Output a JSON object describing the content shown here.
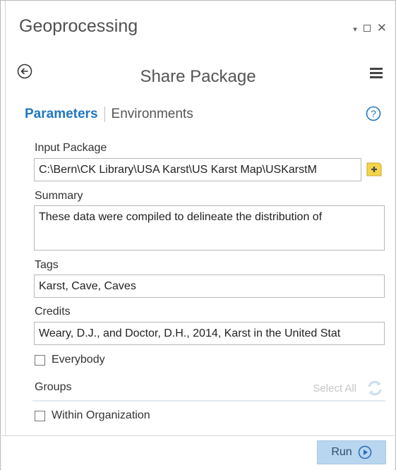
{
  "pane": {
    "title": "Geoprocessing",
    "pin_glyph": "▾",
    "close_glyph": "✕"
  },
  "tool": {
    "title": "Share Package"
  },
  "tabs": {
    "parameters": "Parameters",
    "environments": "Environments"
  },
  "fields": {
    "input_package": {
      "label": "Input Package",
      "value": "C:\\Bern\\CK Library\\USA Karst\\US Karst Map\\USKarstM"
    },
    "summary": {
      "label": "Summary",
      "value": "These data were compiled to delineate the distribution of"
    },
    "tags": {
      "label": "Tags",
      "value": "Karst, Cave, Caves"
    },
    "credits": {
      "label": "Credits",
      "value": "Weary, D.J., and Doctor, D.H., 2014, Karst in the United Stat"
    }
  },
  "options": {
    "everybody": "Everybody",
    "groups_label": "Groups",
    "select_all": "Select All",
    "within_org": "Within Organization"
  },
  "footer": {
    "run_label": "Run"
  },
  "colors": {
    "accent_blue": "#1f78c1",
    "run_button_bg": "#b9d6f0",
    "browse_icon": "#f2d54a",
    "disabled_text": "#c6c6c6"
  },
  "icons": [
    "back-arrow-icon",
    "hamburger-menu-icon",
    "help-icon",
    "add-file-icon",
    "refresh-icon",
    "play-icon"
  ]
}
